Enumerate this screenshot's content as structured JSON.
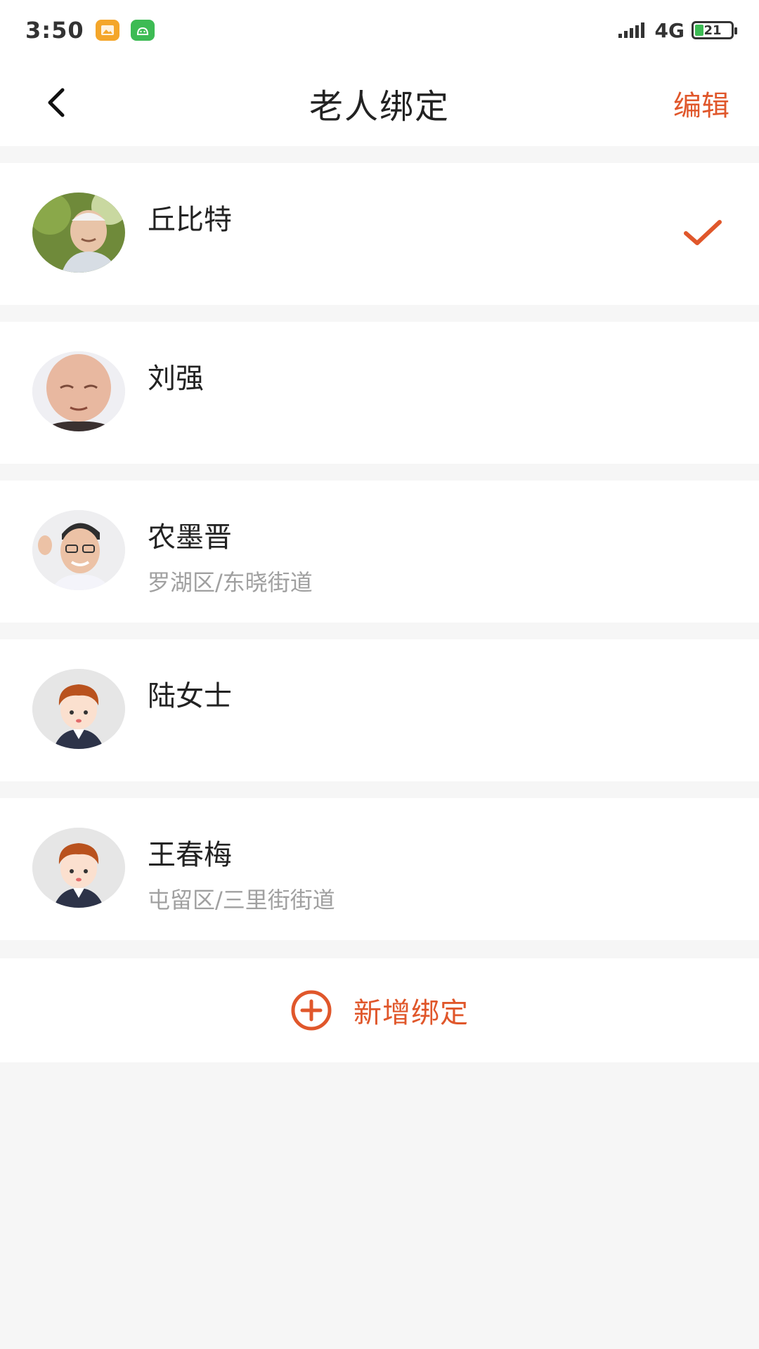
{
  "status_bar": {
    "time": "3:50",
    "network": "4G",
    "battery_level": "21"
  },
  "header": {
    "title": "老人绑定",
    "edit_label": "编辑"
  },
  "elders": [
    {
      "name": "丘比特",
      "address": "",
      "selected": true,
      "avatar": "photo-elder-outdoor"
    },
    {
      "name": "刘强",
      "address": "",
      "selected": false,
      "avatar": "photo-elder-closeup"
    },
    {
      "name": "农墨晋",
      "address": "罗湖区/东晓街道",
      "selected": false,
      "avatar": "photo-man-glasses"
    },
    {
      "name": "陆女士",
      "address": "",
      "selected": false,
      "avatar": "cartoon-default"
    },
    {
      "name": "王春梅",
      "address": "屯留区/三里街街道",
      "selected": false,
      "avatar": "cartoon-default"
    }
  ],
  "add_button": {
    "label": "新增绑定",
    "icon": "plus-circle-icon"
  },
  "colors": {
    "accent": "#e0572b",
    "background": "#f6f6f6"
  }
}
